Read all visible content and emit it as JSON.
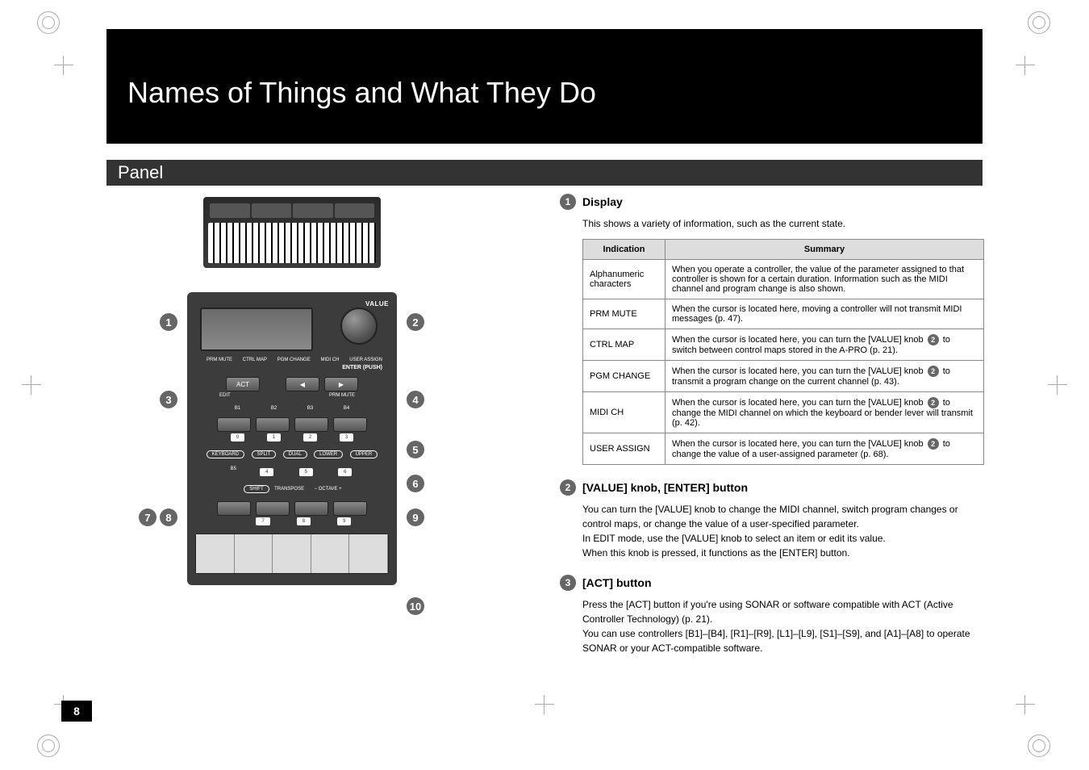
{
  "page_number": "8",
  "title": "Names of Things and What They Do",
  "section": "Panel",
  "panel_labels": {
    "value": "VALUE",
    "enter_push": "ENTER (PUSH)",
    "cursor_labels": [
      "PRM MUTE",
      "CTRL MAP",
      "PGM CHANGE",
      "MIDI CH",
      "USER ASSIGN"
    ],
    "act": "ACT",
    "edit": "EDIT",
    "prm_mute": "PRM MUTE",
    "b_labels": [
      "B1",
      "B2",
      "B3",
      "B4"
    ],
    "num_labels_a": [
      "0",
      "1",
      "2",
      "3"
    ],
    "keyboard": "KEYBOARD",
    "mode_chips": [
      "SPLIT",
      "DUAL",
      "LOWER",
      "UPPER"
    ],
    "b_labels2": [
      "B5",
      "4",
      "5",
      "6"
    ],
    "shift": "SHIFT",
    "transpose": "TRANSPOSE",
    "octave": "−  OCTAVE  +",
    "num_labels_b": [
      "7",
      "8",
      "9"
    ]
  },
  "callouts": [
    "1",
    "2",
    "3",
    "4",
    "5",
    "6",
    "7",
    "8",
    "9",
    "10"
  ],
  "items": [
    {
      "num": "1",
      "title": "Display",
      "desc": "This shows a variety of information, such as the current state.",
      "table": {
        "headers": [
          "Indication",
          "Summary"
        ],
        "rows": [
          {
            "ind": "Alphanumeric characters",
            "sum": "When you operate a controller, the value of the parameter assigned to that controller is shown for a certain duration. Information such as the MIDI channel and program change is also shown."
          },
          {
            "ind": "PRM MUTE",
            "sum_pre": "When the cursor is located here, moving a controller will not transmit MIDI messages (p. 47).",
            "ref": null
          },
          {
            "ind": "CTRL MAP",
            "sum_pre": "When the cursor is located here, you can turn the [VALUE] knob ",
            "ref": "2",
            "sum_post": " to switch between control maps stored in the A-PRO (p. 21)."
          },
          {
            "ind": "PGM CHANGE",
            "sum_pre": "When the cursor is located here, you can turn the [VALUE] knob ",
            "ref": "2",
            "sum_post": " to transmit a program change on the current channel (p. 43)."
          },
          {
            "ind": "MIDI CH",
            "sum_pre": "When the cursor is located here, you can turn the [VALUE] knob ",
            "ref": "2",
            "sum_post": " to change the MIDI channel on which the keyboard or bender lever will transmit (p. 42)."
          },
          {
            "ind": "USER ASSIGN",
            "sum_pre": "When the cursor is located here, you can turn the [VALUE] knob ",
            "ref": "2",
            "sum_post": " to change the value of a user-assigned parameter (p. 68)."
          }
        ]
      }
    },
    {
      "num": "2",
      "title": "[VALUE] knob, [ENTER] button",
      "desc": "You can turn the [VALUE] knob to change the MIDI channel, switch program changes or control maps, or change the value of a user-specified parameter.\nIn EDIT mode, use the [VALUE] knob to select an item or edit its value.\nWhen this knob is pressed, it functions as the [ENTER] button."
    },
    {
      "num": "3",
      "title": "[ACT] button",
      "desc": "Press the [ACT] button if you're using SONAR or software compatible with ACT (Active Controller Technology) (p. 21).\nYou can use controllers [B1]–[B4], [R1]–[R9], [L1]–[L9], [S1]–[S9], and [A1]–[A8] to operate SONAR or your ACT-compatible software."
    }
  ]
}
